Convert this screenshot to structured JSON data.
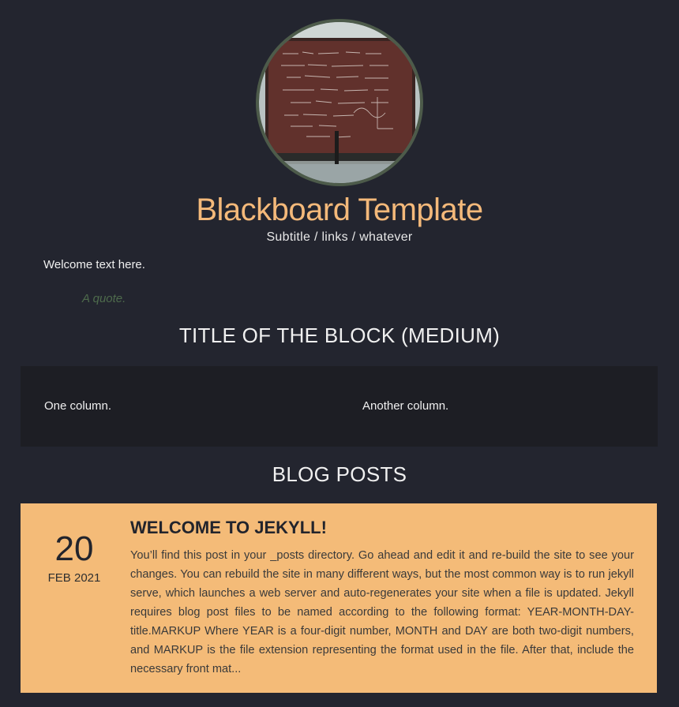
{
  "header": {
    "avatar_alt": "chalkboard-photo",
    "title": "Blackboard Template",
    "subtitle": "Subtitle / links / whatever"
  },
  "intro": {
    "welcome": "Welcome text here.",
    "quote": "A quote."
  },
  "block": {
    "title": "TITLE OF THE BLOCK (MEDIUM)",
    "columns": [
      "One column.",
      "Another column."
    ]
  },
  "blog": {
    "title": "BLOG POSTS",
    "posts": [
      {
        "day": "20",
        "month_year": "FEB 2021",
        "heading": "WELCOME TO JEKYLL!",
        "excerpt": "You’ll find this post in your _posts directory. Go ahead and edit it and re-build the site to see your changes. You can rebuild the site in many different ways, but the most common way is to run jekyll serve, which launches a web server and auto-regenerates your site when a file is updated. Jekyll requires blog post files to be named according to the following format: YEAR-MONTH-DAY-title.MARKUP Where YEAR is a four-digit number, MONTH and DAY are both two-digit numbers, and MARKUP is the file extension representing the format used in the file. After that, include the necessary front mat..."
      }
    ]
  },
  "colors": {
    "background": "#23252f",
    "accent": "#f4b97a",
    "block_bg": "#1d1e24",
    "post_card": "#f4bb78",
    "quote": "#4e6b4c",
    "avatar_border": "#4d5b4a"
  }
}
